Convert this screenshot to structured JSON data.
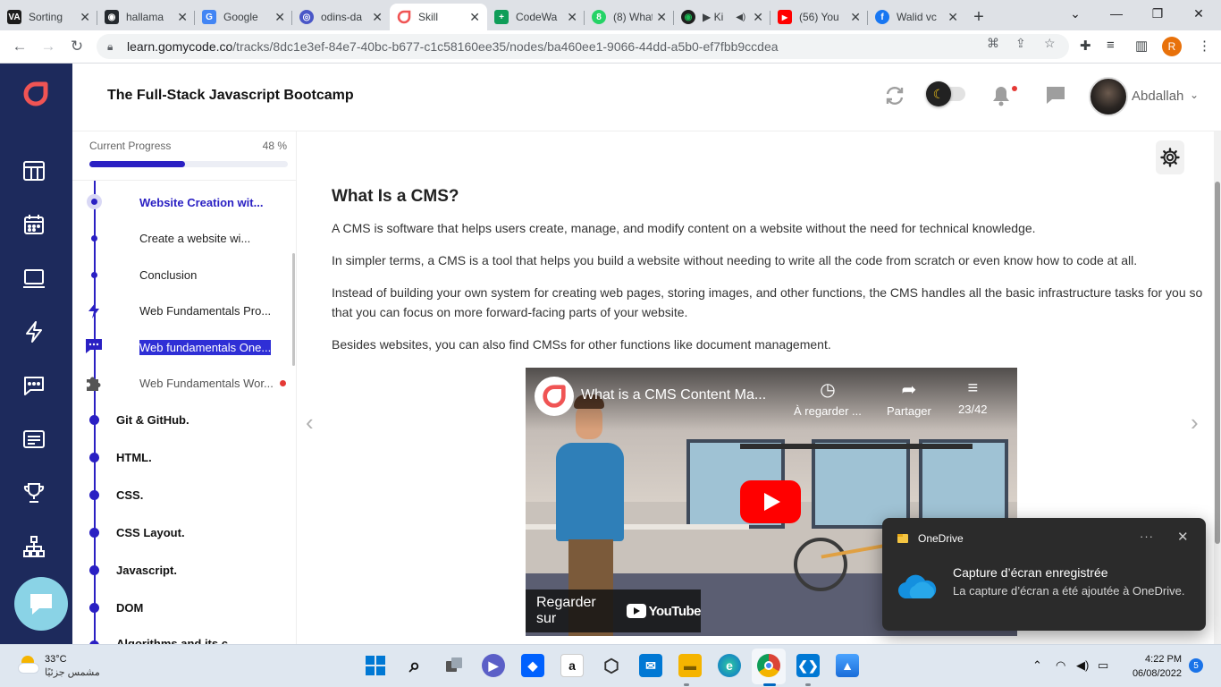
{
  "browser": {
    "tabs": [
      {
        "title": "Sorting",
        "favicon": "va-icon",
        "color": "#1b1b1b",
        "glyph": "VA"
      },
      {
        "title": "hallama",
        "favicon": "github-icon",
        "color": "#24292e",
        "glyph": "◉"
      },
      {
        "title": "Google",
        "favicon": "google-translate-icon",
        "color": "#4285f4",
        "glyph": "G"
      },
      {
        "title": "odins-da",
        "favicon": "odin-icon",
        "color": "#4a57c7",
        "glyph": "◎"
      },
      {
        "title": "Skill",
        "favicon": "gomycode-icon",
        "color": "#ffffff",
        "glyph": ""
      },
      {
        "title": "CodeWa",
        "favicon": "codewars-icon",
        "color": "#0f9d58",
        "glyph": "+"
      },
      {
        "title": "(8) What",
        "favicon": "whatsapp-icon",
        "color": "#25d366",
        "glyph": "8"
      },
      {
        "title": "▶ Ki",
        "favicon": "spotify-icon",
        "color": "#1e1e1e",
        "glyph": "◉"
      },
      {
        "title": "(56) You",
        "favicon": "youtube-icon",
        "color": "#ff0000",
        "glyph": "▶"
      },
      {
        "title": "Walid vc",
        "favicon": "facebook-icon",
        "color": "#1877f2",
        "glyph": "f"
      }
    ],
    "new_tab": "+",
    "url_host": "learn.gomycode.co",
    "url_path": "/tracks/8dc1e3ef-84e7-40bc-b677-c1c58160ee35/nodes/ba460ee1-9066-44dd-a5b0-ef7fbb9ccdea",
    "profile_initial": "R"
  },
  "header": {
    "course_title": "The Full-Stack Javascript Bootcamp",
    "user_name": "Abdallah"
  },
  "progress": {
    "label": "Current Progress",
    "percent_text": "48 %",
    "value": 0.48
  },
  "syllabus": {
    "lessons": [
      {
        "title": "Website Creation wit...",
        "type": "current"
      },
      {
        "title": "Create a website wi...",
        "type": "lesson"
      },
      {
        "title": "Conclusion",
        "type": "lesson"
      },
      {
        "title": "Web Fundamentals Pro...",
        "type": "lightning"
      },
      {
        "title": "Web fundamentals One...",
        "type": "chat"
      },
      {
        "title": "Web Fundamentals Wor...",
        "type": "puzzle"
      }
    ],
    "modules": [
      "Git & GitHub.",
      "HTML.",
      "CSS.",
      "CSS Layout.",
      "Javascript.",
      "DOM",
      "Algorithms and its c..."
    ]
  },
  "content": {
    "heading": "What Is a CMS?",
    "paragraphs": [
      "A CMS is software that helps users create, manage, and modify content on a website without the need for technical knowledge.",
      "In simpler terms, a CMS is a tool that helps you build a website without needing to write all the code from scratch or even know how to code at all.",
      "Instead of building your own system for creating web pages, storing images, and other functions, the CMS handles all the basic infrastructure tasks for you so that you can focus on more forward-facing parts of your website.",
      "Besides websites, you can also find CMSs for other functions like document management."
    ],
    "video": {
      "title": "What is a CMS Content Ma...",
      "watch_later": "À regarder ...",
      "share": "Partager",
      "playlist": "23/42",
      "watch_on": "Regarder sur",
      "youtube": "YouTube"
    }
  },
  "toast": {
    "app": "OneDrive",
    "more": "···",
    "title": "Capture d’écran enregistrée",
    "body": "La capture d’écran a été ajoutée à OneDrive."
  },
  "taskbar": {
    "temperature": "33°C",
    "weather_desc": "مشمس جزئيًا",
    "time": "4:22 PM",
    "date": "06/08/2022",
    "notifications": "5"
  },
  "colors": {
    "brand": "#2a20c3",
    "rail": "#1d2a5c",
    "accent_red": "#f05454"
  }
}
